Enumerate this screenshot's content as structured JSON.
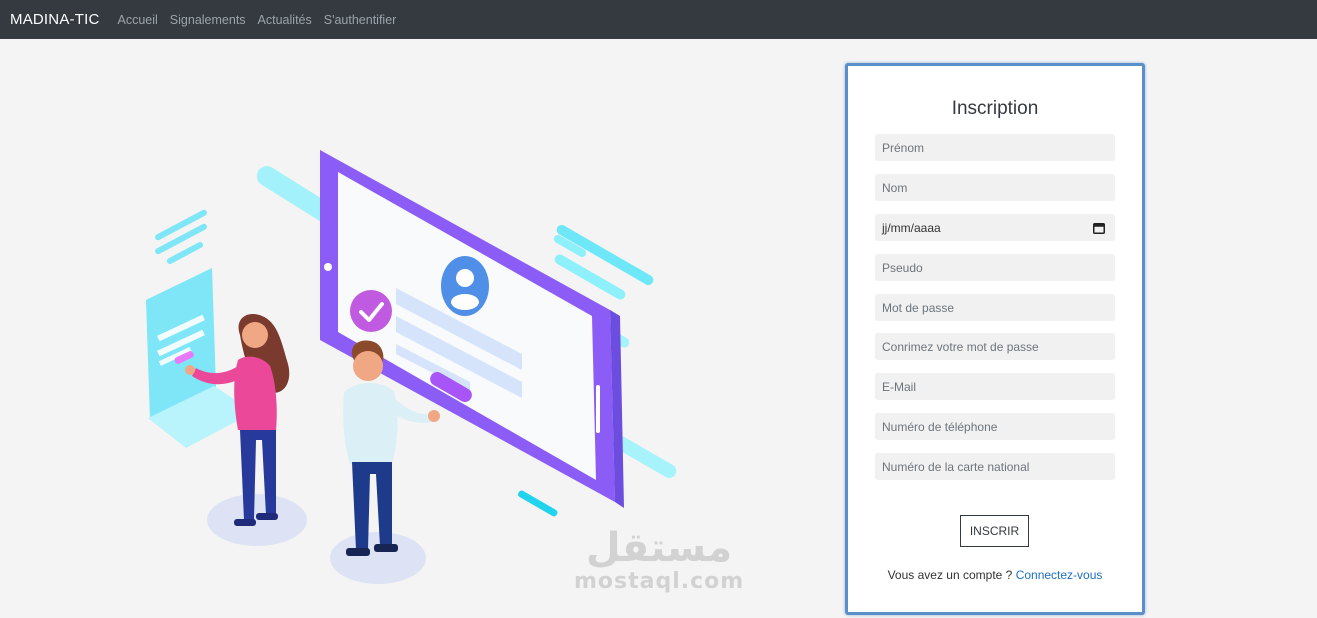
{
  "navbar": {
    "brand": "MADINA-TIC",
    "links": [
      "Accueil",
      "Signalements",
      "Actualités",
      "S'authentifier"
    ]
  },
  "form": {
    "title": "Inscription",
    "fields": {
      "prenom": "Prénom",
      "nom": "Nom",
      "date": "jj/mm/aaaa",
      "pseudo": "Pseudo",
      "password": "Mot de passe",
      "confirm": "Conrimez votre mot de passe",
      "email": "E-Mail",
      "phone": "Numéro de téléphone",
      "national_id": "Numéro de la carte national"
    },
    "submit_label": "INSCRIR",
    "footer_text": "Vous avez un compte ?",
    "footer_link": "Connectez-vous"
  },
  "watermark": {
    "arabic": "مستقل",
    "latin": "mostaql.com"
  },
  "colors": {
    "navbar_bg": "#343a40",
    "card_border": "#5b8fc9",
    "link": "#1e6ec0",
    "tablet_purple": "#8b5cf6",
    "cyan_accent": "#6ee7f9",
    "pink": "#ec4899"
  }
}
